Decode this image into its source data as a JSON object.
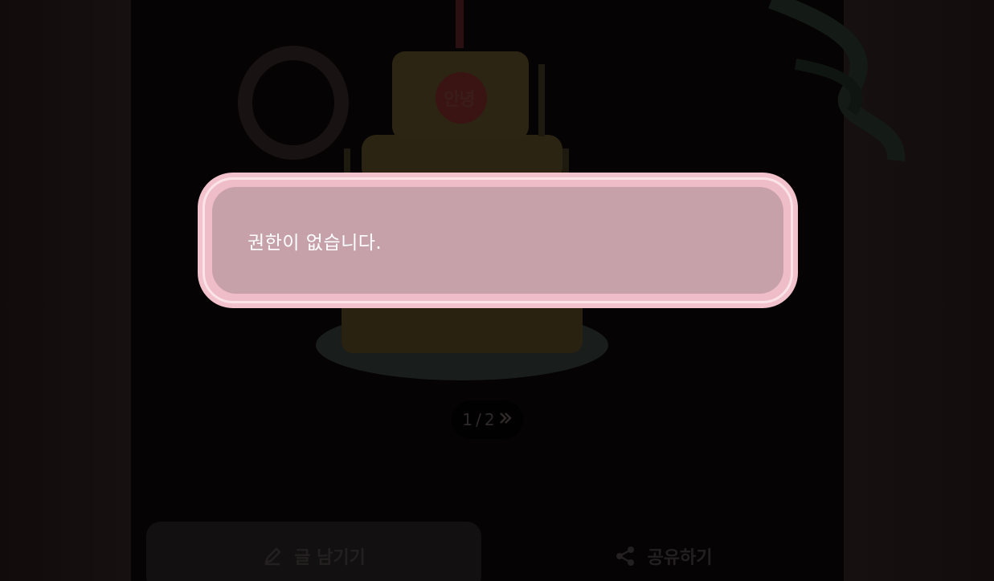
{
  "background_scene": {
    "cake_label": "안녕",
    "pager": {
      "current": "1",
      "separator": "/",
      "total": "2",
      "next_icon": "double-chevron-right-icon"
    }
  },
  "bottom_bar": {
    "write_button": {
      "label": "글 남기기",
      "icon": "pen-icon"
    },
    "share_button": {
      "label": "공유하기",
      "icon": "share-icon"
    }
  },
  "alert": {
    "message": "권한이 없습니다."
  },
  "colors": {
    "modal_border": "#f3c3cd",
    "modal_fill": "#c6a1aa",
    "overlay": "#050303"
  }
}
